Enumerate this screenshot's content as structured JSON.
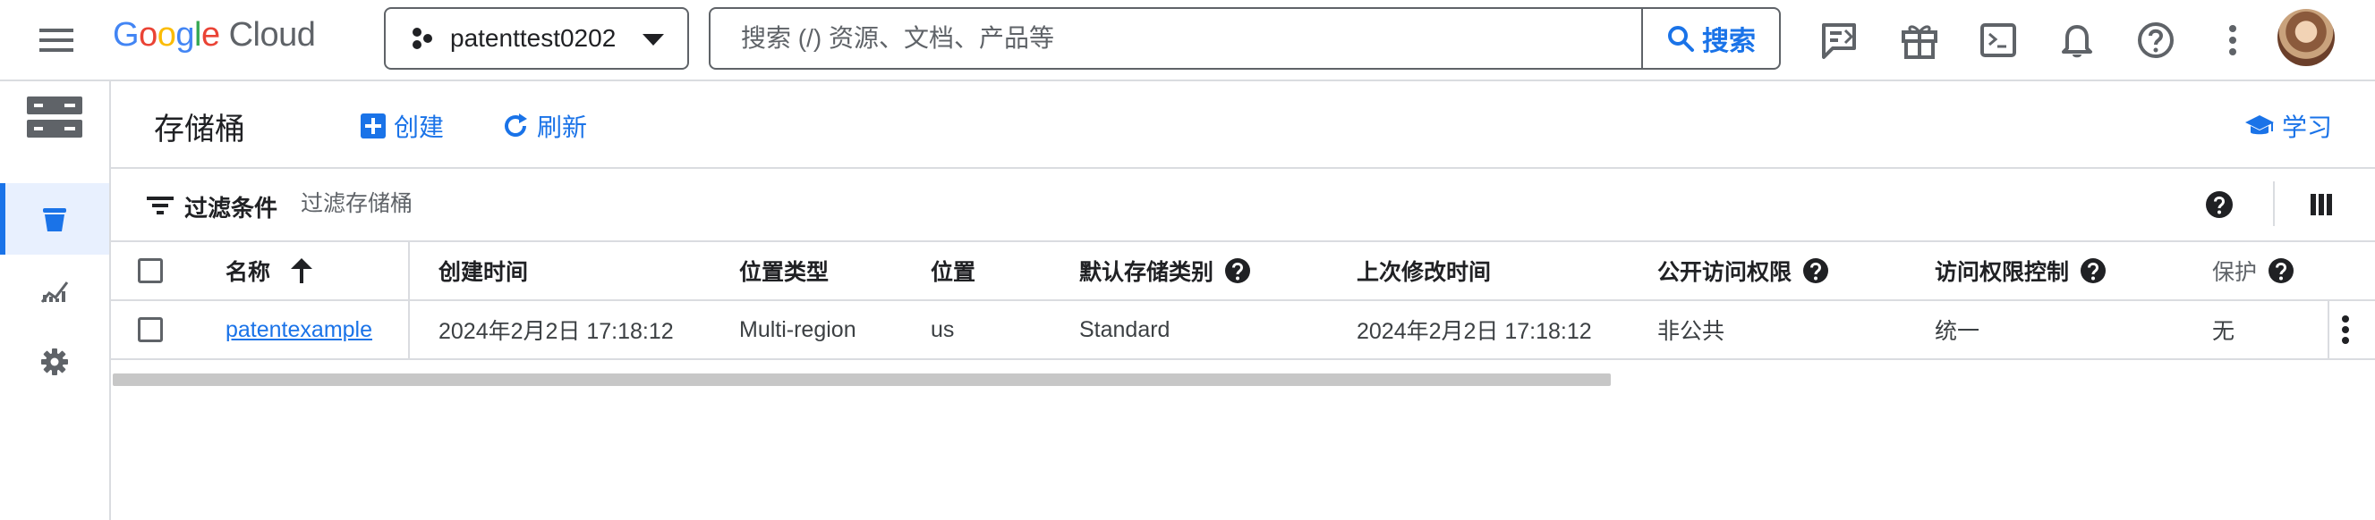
{
  "topbar": {
    "logo_letters": [
      "G",
      "o",
      "o",
      "g",
      "l",
      "e"
    ],
    "logo_suffix": "Cloud",
    "project_name": "patenttest0202",
    "search": {
      "placeholder": "搜索 (/) 资源、文档、产品等",
      "button_label": "搜索"
    }
  },
  "leftnav": {
    "items": [
      {
        "icon": "storage-logo-icon"
      },
      {
        "icon": "bucket-icon",
        "active": true
      },
      {
        "icon": "analytics-icon"
      },
      {
        "icon": "gear-icon"
      }
    ]
  },
  "header": {
    "title": "存储桶",
    "create_label": "创建",
    "refresh_label": "刷新",
    "learn_label": "学习"
  },
  "filter": {
    "label": "过滤条件",
    "placeholder": "过滤存储桶"
  },
  "table": {
    "columns": {
      "name": "名称",
      "created": "创建时间",
      "location_type": "位置类型",
      "location": "位置",
      "storage_class": "默认存储类别",
      "modified": "上次修改时间",
      "public_access": "公开访问权限",
      "access_control": "访问权限控制",
      "protection": "保护"
    },
    "rows": [
      {
        "name": "patentexample",
        "created": "2024年2月2日 17:18:12",
        "location_type": "Multi-region",
        "location": "us",
        "storage_class": "Standard",
        "modified": "2024年2月2日 17:18:12",
        "public_access": "非公共",
        "access_control": "统一",
        "protection": "无"
      }
    ]
  },
  "colors": {
    "accent": "#1a73e8",
    "border": "#dadce0",
    "icon": "#5f6368",
    "text": "#202124"
  }
}
